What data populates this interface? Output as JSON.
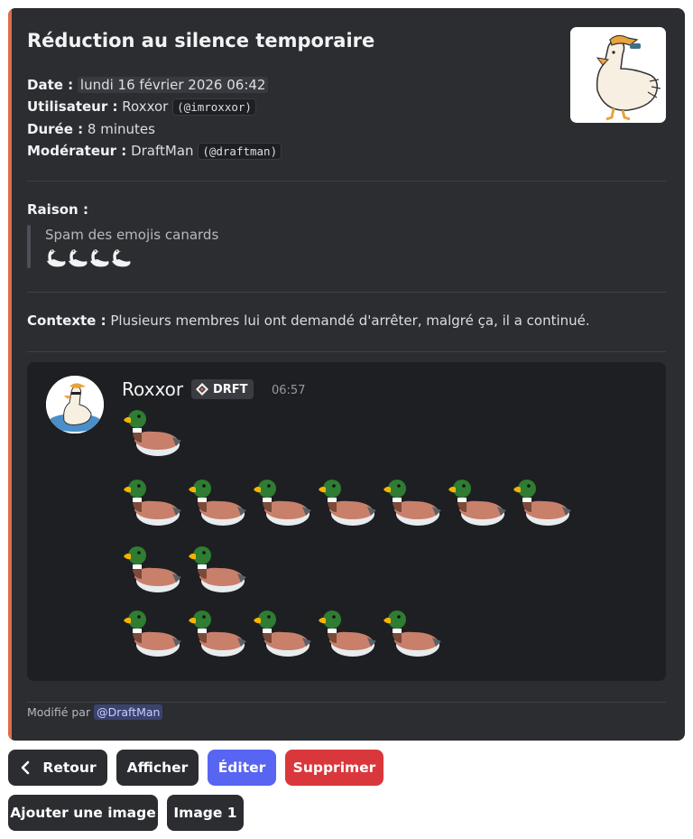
{
  "embed": {
    "title": "Réduction au silence temporaire",
    "accent_color": "#e06c4a",
    "fields": {
      "date_label": "Date :",
      "date_value": "lundi 16 février 2026 06:42",
      "user_label": "Utilisateur :",
      "user_name": "Roxxor",
      "user_handle": "(@imroxxor)",
      "duration_label": "Durée :",
      "duration_value": "8 minutes",
      "moderator_label": "Modérateur :",
      "moderator_name": "DraftMan",
      "moderator_handle": "(@draftman)"
    },
    "reason": {
      "label": "Raison :",
      "text": "Spam des emojis canards",
      "emoji_count": 4,
      "emoji": "swan"
    },
    "context": {
      "label": "Contexte :",
      "text": "Plusieurs membres lui ont demandé d'arrêter, malgré ça, il a continué."
    },
    "message": {
      "author": "Roxxor",
      "tag": "DRFT",
      "time": "06:57",
      "duck_rows": [
        1,
        7,
        2,
        5
      ],
      "emoji": "duck"
    },
    "footer": {
      "prefix": "Modifié par",
      "mention": "@DraftMan"
    }
  },
  "buttons": {
    "back": "Retour",
    "show": "Afficher",
    "edit": "Éditer",
    "delete": "Supprimer",
    "add_image": "Ajouter une image",
    "image1": "Image 1"
  },
  "colors": {
    "primary": "#5865f2",
    "danger": "#da373c",
    "secondary": "#2b2d31"
  }
}
